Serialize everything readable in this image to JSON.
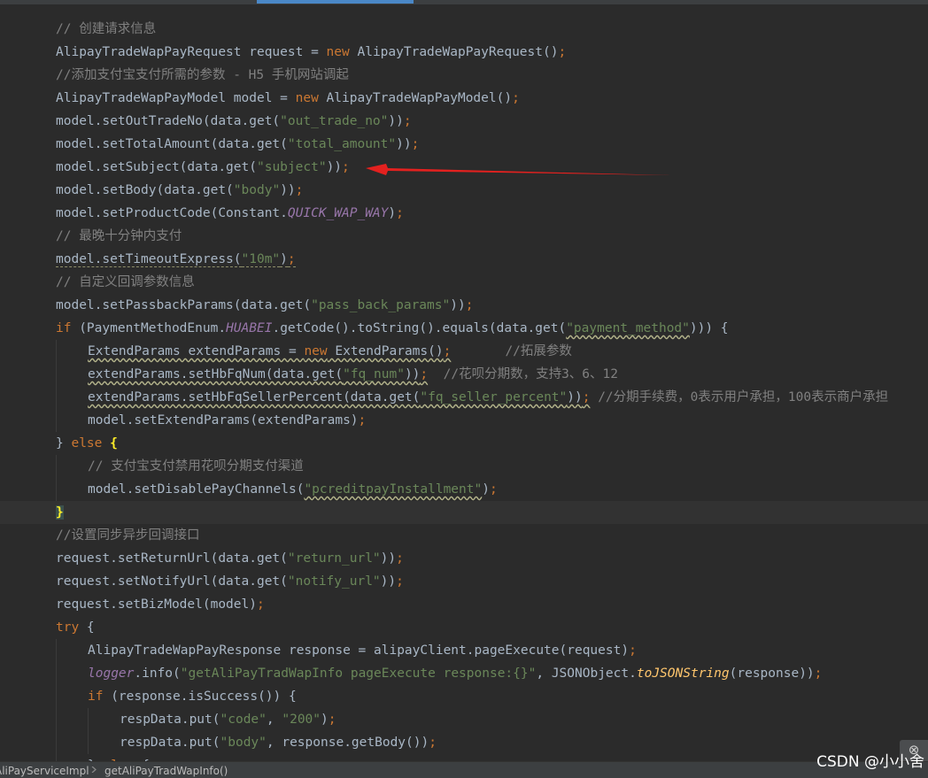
{
  "editor": {
    "lines": [
      [
        {
          "t": "// 创建请求信息",
          "c": "cmt"
        }
      ],
      [
        {
          "t": "AlipayTradeWapPayRequest request = "
        },
        {
          "t": "new",
          "c": "kw"
        },
        {
          "t": " AlipayTradeWapPayRequest()"
        },
        {
          "t": ";",
          "c": "kw"
        }
      ],
      [
        {
          "t": "//添加支付宝支付所需的参数 - H5 手机网站调起",
          "c": "cmt"
        }
      ],
      [
        {
          "t": "AlipayTradeWapPayModel model = "
        },
        {
          "t": "new",
          "c": "kw"
        },
        {
          "t": " AlipayTradeWapPayModel()"
        },
        {
          "t": ";",
          "c": "kw"
        }
      ],
      [
        {
          "t": "model.setOutTradeNo(data.get("
        },
        {
          "t": "\"out_trade_no\"",
          "c": "str"
        },
        {
          "t": "))"
        },
        {
          "t": ";",
          "c": "kw"
        }
      ],
      [
        {
          "t": "model.setTotalAmount(data.get("
        },
        {
          "t": "\"total_amount\"",
          "c": "str"
        },
        {
          "t": "))"
        },
        {
          "t": ";",
          "c": "kw"
        }
      ],
      [
        {
          "t": "model.setSubject(data.get("
        },
        {
          "t": "\"subject\"",
          "c": "str"
        },
        {
          "t": "))"
        },
        {
          "t": ";",
          "c": "kw"
        }
      ],
      [
        {
          "t": "model.setBody(data.get("
        },
        {
          "t": "\"body\"",
          "c": "str"
        },
        {
          "t": "))"
        },
        {
          "t": ";",
          "c": "kw"
        }
      ],
      [
        {
          "t": "model.setProductCode(Constant."
        },
        {
          "t": "QUICK_WAP_WAY",
          "c": "field"
        },
        {
          "t": ")"
        },
        {
          "t": ";",
          "c": "kw"
        }
      ],
      [
        {
          "t": "// 最晚十分钟内支付",
          "c": "cmt"
        }
      ],
      [
        {
          "t": "model.setTimeoutExpress(",
          "c": "warn"
        },
        {
          "t": "\"10m\"",
          "c": "str warn"
        },
        {
          "t": ")",
          "c": "warn"
        },
        {
          "t": ";",
          "c": "kw warn"
        }
      ],
      [
        {
          "t": "// 自定义回调参数信息",
          "c": "cmt"
        }
      ],
      [
        {
          "t": "model.setPassbackParams(data.get("
        },
        {
          "t": "\"pass_back_params\"",
          "c": "str"
        },
        {
          "t": "))"
        },
        {
          "t": ";",
          "c": "kw"
        }
      ],
      [
        {
          "t": "if",
          "c": "kw"
        },
        {
          "t": " (PaymentMethodEnum."
        },
        {
          "t": "HUABEI",
          "c": "field"
        },
        {
          "t": ".getCode().toString().equals(data.get("
        },
        {
          "t": "\"payment_method\"",
          "c": "str wavy"
        },
        {
          "t": "))) {"
        }
      ],
      [
        {
          "t": "ExtendParams extendParams = ",
          "c": "wavy"
        },
        {
          "t": "new",
          "c": "kw wavy"
        },
        {
          "t": " ExtendParams()",
          "c": "wavy"
        },
        {
          "t": ";",
          "c": "kw wavy"
        },
        {
          "t": "       "
        },
        {
          "t": "//拓展参数",
          "c": "cmt"
        }
      ],
      [
        {
          "t": "extendParams.setHbFqNum(data.get(",
          "c": "wavy"
        },
        {
          "t": "\"fq_num\"",
          "c": "str wavy"
        },
        {
          "t": "))",
          "c": "wavy"
        },
        {
          "t": ";",
          "c": "kw wavy"
        },
        {
          "t": "  "
        },
        {
          "t": "//花呗分期数，支持3、6、12",
          "c": "cmt"
        }
      ],
      [
        {
          "t": "extendParams.setHbFqSellerPercent(data.get(",
          "c": "wavy"
        },
        {
          "t": "\"fq_seller_percent\"",
          "c": "str wavy"
        },
        {
          "t": "))",
          "c": "wavy"
        },
        {
          "t": ";",
          "c": "kw wavy"
        },
        {
          "t": " "
        },
        {
          "t": "//分期手续费，0表示用户承担，100表示商户承担",
          "c": "cmt"
        }
      ],
      [
        {
          "t": "model.setExtendParams(extendParams)"
        },
        {
          "t": ";",
          "c": "kw"
        }
      ],
      [
        {
          "t": "} "
        },
        {
          "t": "else",
          "c": "kw"
        },
        {
          "t": " "
        },
        {
          "t": "{",
          "c": "brace"
        }
      ],
      [
        {
          "t": "// 支付宝支付禁用花呗分期支付渠道",
          "c": "cmt"
        }
      ],
      [
        {
          "t": "model.setDisablePayChannels("
        },
        {
          "t": "\"pcreditpayInstallment\"",
          "c": "str wavy"
        },
        {
          "t": ")"
        },
        {
          "t": ";",
          "c": "kw"
        }
      ],
      [
        {
          "t": "}",
          "c": "brace matchbg"
        }
      ],
      [
        {
          "t": "//设置同步异步回调接口",
          "c": "cmt"
        }
      ],
      [
        {
          "t": "request.setReturnUrl(data.get("
        },
        {
          "t": "\"return_url\"",
          "c": "str"
        },
        {
          "t": "))"
        },
        {
          "t": ";",
          "c": "kw"
        }
      ],
      [
        {
          "t": "request.setNotifyUrl(data.get("
        },
        {
          "t": "\"notify_url\"",
          "c": "str"
        },
        {
          "t": "))"
        },
        {
          "t": ";",
          "c": "kw"
        }
      ],
      [
        {
          "t": "request.setBizModel(model)"
        },
        {
          "t": ";",
          "c": "kw"
        }
      ],
      [
        {
          "t": "try",
          "c": "kw"
        },
        {
          "t": " {"
        }
      ],
      [
        {
          "t": "AlipayTradeWapPayResponse response = alipayClient.pageExecute(request)"
        },
        {
          "t": ";",
          "c": "kw"
        }
      ],
      [
        {
          "t": "logger",
          "c": "log"
        },
        {
          "t": ".info("
        },
        {
          "t": "\"getAliPayTradWapInfo pageExecute response:{}\"",
          "c": "str"
        },
        {
          "t": ", JSONObject."
        },
        {
          "t": "toJSONString",
          "c": "meth"
        },
        {
          "t": "(response))"
        },
        {
          "t": ";",
          "c": "kw"
        }
      ],
      [
        {
          "t": "if",
          "c": "kw"
        },
        {
          "t": " (response.isSuccess()) {"
        }
      ],
      [
        {
          "t": "respData.put("
        },
        {
          "t": "\"code\"",
          "c": "str"
        },
        {
          "t": ", "
        },
        {
          "t": "\"200\"",
          "c": "str"
        },
        {
          "t": ")"
        },
        {
          "t": ";",
          "c": "kw"
        }
      ],
      [
        {
          "t": "respData.put("
        },
        {
          "t": "\"body\"",
          "c": "str"
        },
        {
          "t": ", response.getBody())"
        },
        {
          "t": ";",
          "c": "kw"
        }
      ],
      [
        {
          "t": "} "
        },
        {
          "t": "else",
          "c": "kw"
        },
        {
          "t": " {"
        }
      ]
    ]
  },
  "statusbar": {
    "breadcrumb_class": "AliPayServiceImpl",
    "breadcrumb_method": "getAliPayTradWapInfo()"
  },
  "watermark": "CSDN @小小舍",
  "side_icon_glyph": "⊗",
  "annotation": "red-arrow"
}
